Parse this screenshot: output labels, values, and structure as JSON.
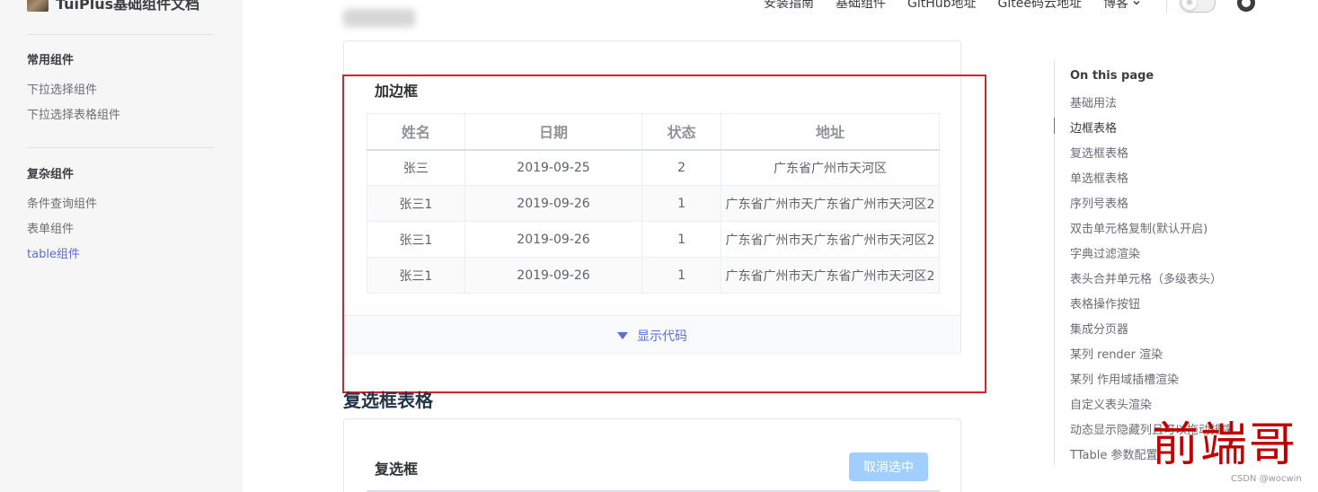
{
  "sidebar": {
    "brand_title": "TuiPlus基础组件文档",
    "groups": [
      {
        "title": "常用组件",
        "items": [
          {
            "label": "下拉选择组件"
          },
          {
            "label": "下拉选择表格组件"
          }
        ]
      },
      {
        "title": "复杂组件",
        "items": [
          {
            "label": "条件查询组件"
          },
          {
            "label": "表单组件"
          },
          {
            "label": "table组件",
            "active": true
          }
        ]
      }
    ]
  },
  "nav": {
    "items": [
      "安装指南",
      "基础组件",
      "GitHub地址",
      "Gitee码云地址"
    ],
    "dropdown_label": "博客",
    "theme_toggle_icon": "sun-icon",
    "repo_icon": "github-icon"
  },
  "demo": {
    "title": "加边框",
    "columns": [
      "姓名",
      "日期",
      "状态",
      "地址"
    ],
    "rows": [
      [
        "张三",
        "2019-09-25",
        "2",
        "广东省广州市天河区"
      ],
      [
        "张三1",
        "2019-09-26",
        "1",
        "广东省广州市天广东省广州市天河区2"
      ],
      [
        "张三1",
        "2019-09-26",
        "1",
        "广东省广州市天广东省广州市天河区2"
      ],
      [
        "张三1",
        "2019-09-26",
        "1",
        "广东省广州市天广东省广州市天河区2"
      ]
    ],
    "show_code_label": "显示代码",
    "highlight_color": "#d8232a"
  },
  "section2": {
    "heading": "复选框表格",
    "card_title": "复选框",
    "cancel_button": "取消选中"
  },
  "outline": {
    "title": "On this page",
    "items": [
      "基础用法",
      "边框表格",
      "复选框表格",
      "单选框表格",
      "序列号表格",
      "双击单元格复制(默认开启)",
      "字典过滤渲染",
      "表头合并单元格（多级表头）",
      "表格操作按钮",
      "集成分页器",
      "某列 render 渲染",
      "某列 作用域插槽渲染",
      "自定义表头渲染",
      "动态显示隐藏列且可以拖动排序",
      "TTable 参数配置"
    ],
    "active_index": 1
  },
  "watermark": {
    "text": "前端哥",
    "credit": "CSDN @wocwin"
  },
  "colors": {
    "accent": "#5c6bdf",
    "highlight_red": "#d8232a",
    "watermark_red": "#c00000",
    "disabled_button": "#a0cfff"
  }
}
